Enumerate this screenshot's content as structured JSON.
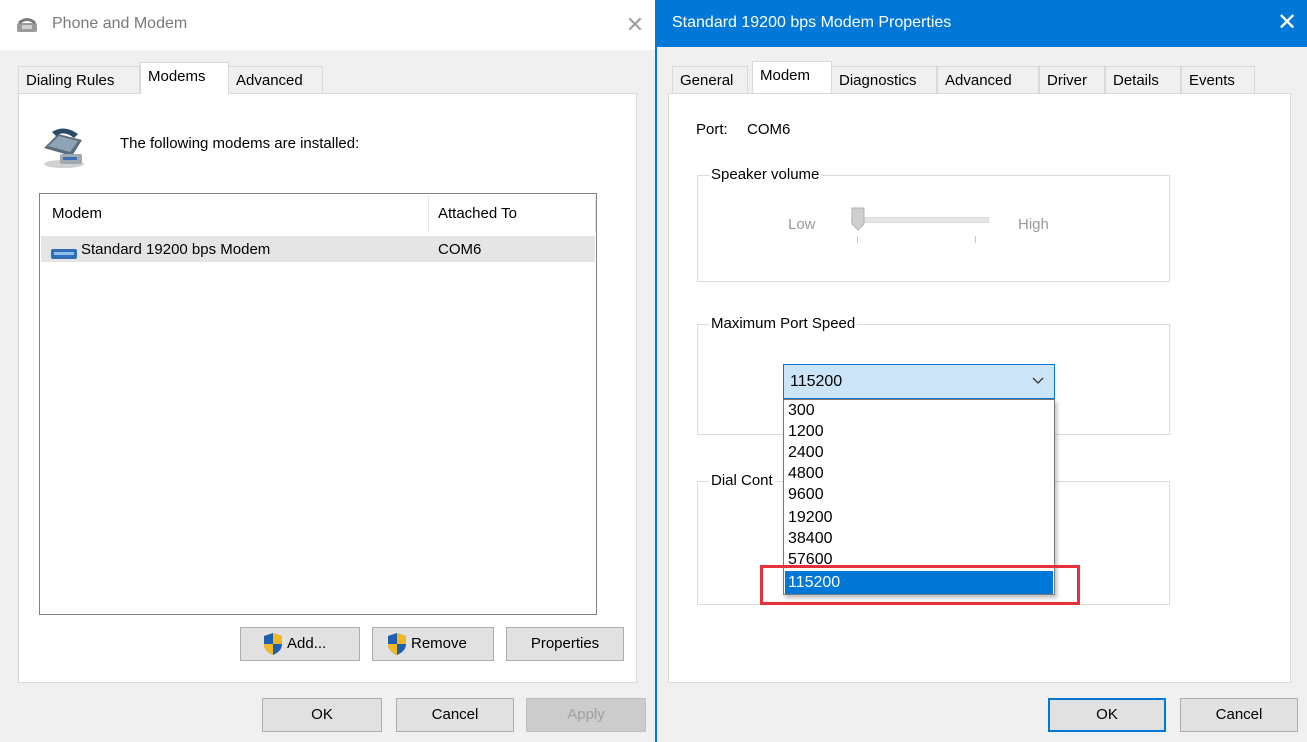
{
  "left_window": {
    "title": "Phone and Modem",
    "close_glyph": "✕",
    "tabs": [
      {
        "label": "Dialing Rules"
      },
      {
        "label": "Modems"
      },
      {
        "label": "Advanced"
      }
    ],
    "intro": "The following modems are installed:",
    "columns": {
      "modem": "Modem",
      "attached": "Attached To"
    },
    "rows": [
      {
        "modem": "Standard 19200 bps Modem",
        "attached": "COM6"
      }
    ],
    "buttons": {
      "add": "Add...",
      "remove": "Remove",
      "properties": "Properties"
    },
    "footer": {
      "ok": "OK",
      "cancel": "Cancel",
      "apply": "Apply"
    }
  },
  "right_window": {
    "title": "Standard 19200 bps Modem Properties",
    "close_glyph": "✕",
    "tabs": [
      {
        "label": "General"
      },
      {
        "label": "Modem"
      },
      {
        "label": "Diagnostics"
      },
      {
        "label": "Advanced"
      },
      {
        "label": "Driver"
      },
      {
        "label": "Details"
      },
      {
        "label": "Events"
      }
    ],
    "port_label": "Port:",
    "port_value": "COM6",
    "speaker_volume": {
      "label": "Speaker volume",
      "low": "Low",
      "high": "High"
    },
    "max_port_speed": {
      "label": "Maximum Port Speed",
      "selected": "115200",
      "options": [
        "300",
        "1200",
        "2400",
        "4800",
        "9600",
        "19200",
        "38400",
        "57600",
        "115200"
      ]
    },
    "dial_control": {
      "label": "Dial Cont"
    },
    "footer": {
      "ok": "OK",
      "cancel": "Cancel"
    }
  },
  "colors": {
    "accent": "#0078d7",
    "highlight_box": "#e8303b",
    "selection_bg": "#cce4f7"
  }
}
